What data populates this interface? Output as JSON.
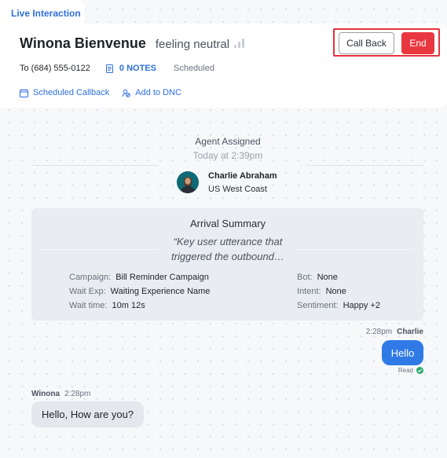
{
  "tab": {
    "label": "Live Interaction"
  },
  "contact": {
    "name": "Winona Bienvenue",
    "mood": "feeling neutral",
    "phone": "To (684) 555-0122",
    "notes_label": "0 NOTES",
    "status": "Scheduled"
  },
  "actions": {
    "call_back": "Call Back",
    "end": "End"
  },
  "links": {
    "scheduled_callback": "Scheduled Callback",
    "add_to_dnc": "Add to DNC"
  },
  "event": {
    "title": "Agent Assigned",
    "time": "Today at 2:39pm",
    "agent_name": "Charlie Abraham",
    "agent_location": "US West Coast"
  },
  "summary": {
    "title": "Arrival Summary",
    "quote_line1": "“Key user utterance that",
    "quote_line2": "triggered the outbound…",
    "campaign_label": "Campaign:",
    "campaign_value": "Bill Reminder Campaign",
    "wait_exp_label": "Wait Exp:",
    "wait_exp_value": "Waiting Experience Name",
    "wait_time_label": "Wait time:",
    "wait_time_value": "10m 12s",
    "bot_label": "Bot:",
    "bot_value": "None",
    "intent_label": "Intent:",
    "intent_value": "None",
    "sentiment_label": "Sentiment:",
    "sentiment_value": "Happy +2"
  },
  "messages": [
    {
      "time": "2:28pm",
      "sender": "Charlie",
      "text": "Hello",
      "status": "Read"
    },
    {
      "time": "2:28pm",
      "sender": "Winona",
      "text": "Hello, How are you?"
    }
  ],
  "colors": {
    "accent": "#2f6fdd",
    "end_button": "#e8373f",
    "highlight_frame": "#e5323b",
    "outgoing_bubble": "#2f7ae5",
    "read_check": "#29a86a"
  },
  "icons": {
    "notes": "document-icon",
    "scheduled_callback": "calendar-icon",
    "add_to_dnc": "block-icon",
    "signal": "signal-bars-icon",
    "read": "check-circle-icon"
  }
}
